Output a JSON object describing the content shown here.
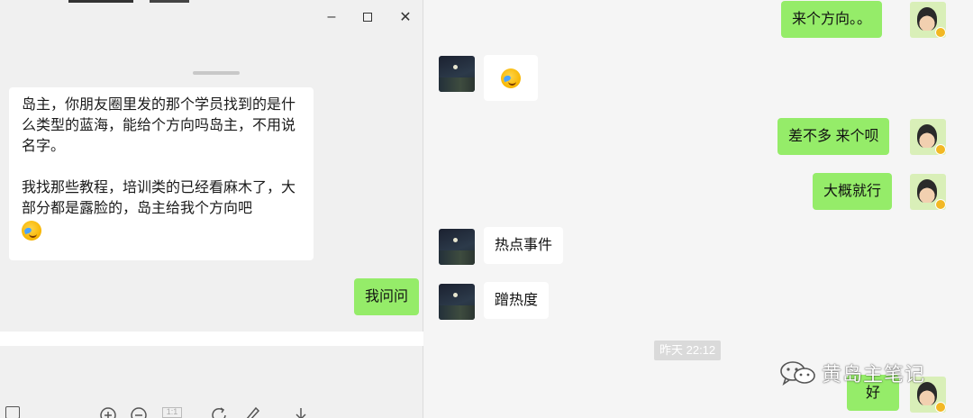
{
  "popup_window": {
    "controls": {
      "minimize": "–",
      "maximize": "□",
      "close": "✕"
    },
    "quoted_message": {
      "paragraph1": "岛主，你朋友圈里发的那个学员找到的是什么类型的蓝海，能给个方向吗岛主，不用说名字。",
      "paragraph2": "我找那些教程，培训类的已经看麻木了，大部分都是露脸的，岛主给我个方向吧",
      "emoji": "facepalm-emoji"
    },
    "sent_message": "我问问",
    "toolbar": {
      "icons": [
        "screenshot-icon",
        "zoom-in-icon",
        "zoom-out-icon",
        "actual-size-icon",
        "rotate-icon",
        "edit-icon",
        "download-icon"
      ],
      "actual_size_label": "1:1"
    }
  },
  "chat": {
    "messages": [
      {
        "side": "out",
        "text": "来个方向。。"
      },
      {
        "side": "in",
        "text": "",
        "emoji": "facepalm-emoji"
      },
      {
        "side": "out",
        "text": "差不多 来个呗"
      },
      {
        "side": "out",
        "text": "大概就行"
      },
      {
        "side": "in",
        "text": "热点事件"
      },
      {
        "side": "in",
        "text": "蹭热度"
      },
      {
        "side": "out",
        "text": "好"
      }
    ],
    "timestamp": "昨天 22:12"
  },
  "watermark": {
    "text": "黄岛主笔记"
  },
  "colors": {
    "outgoing": "#95ec69",
    "incoming": "#ffffff",
    "background": "#f5f5f5"
  }
}
